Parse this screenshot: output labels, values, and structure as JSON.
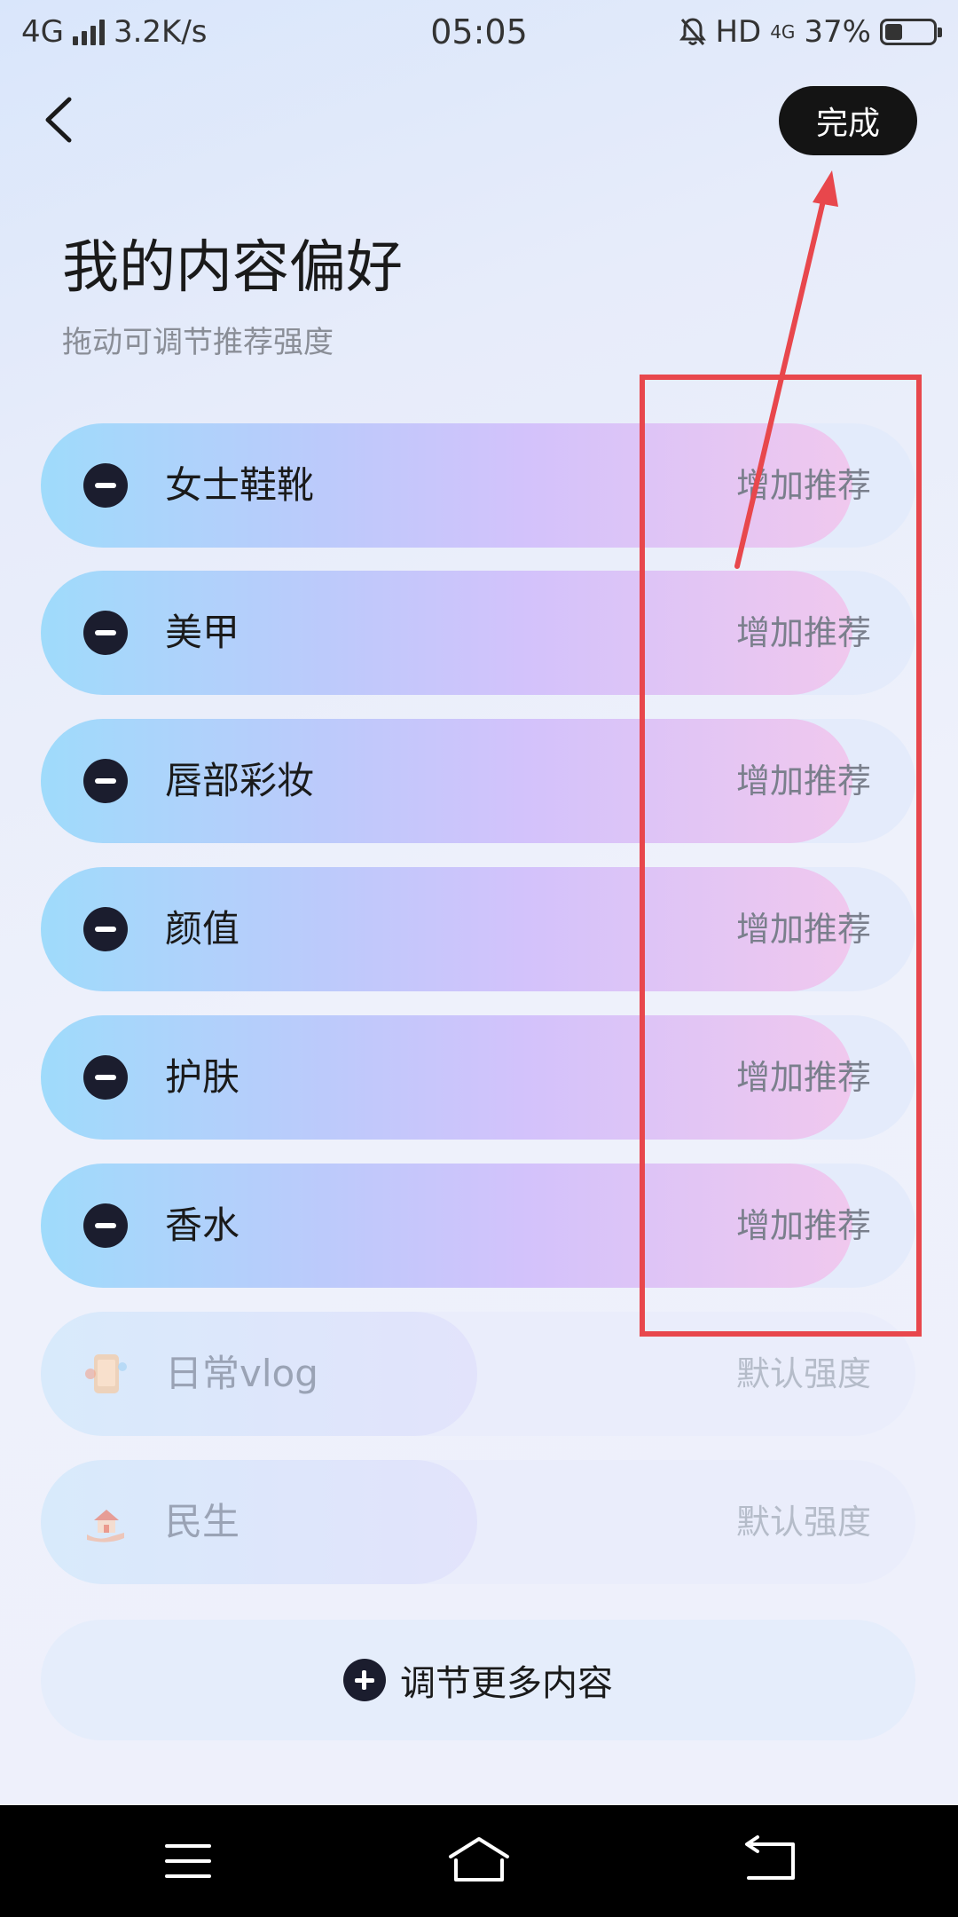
{
  "status_bar": {
    "network": "4G",
    "speed": "3.2K/s",
    "time": "05:05",
    "hd": "HD",
    "net_small": "4G",
    "battery_text": "37%",
    "battery_level": 0.37
  },
  "header": {
    "done_label": "完成",
    "title": "我的内容偏好",
    "subtitle": "拖动可调节推荐强度"
  },
  "preferences": [
    {
      "label": "女士鞋靴",
      "action": "增加推荐",
      "state": "active"
    },
    {
      "label": "美甲",
      "action": "增加推荐",
      "state": "active"
    },
    {
      "label": "唇部彩妆",
      "action": "增加推荐",
      "state": "active"
    },
    {
      "label": "颜值",
      "action": "增加推荐",
      "state": "active"
    },
    {
      "label": "护肤",
      "action": "增加推荐",
      "state": "active"
    },
    {
      "label": "香水",
      "action": "增加推荐",
      "state": "active"
    },
    {
      "label": "日常vlog",
      "action": "默认强度",
      "state": "default",
      "icon": "daily-vlog-icon"
    },
    {
      "label": "民生",
      "action": "默认强度",
      "state": "default",
      "icon": "livelihood-icon"
    }
  ],
  "more_button": {
    "label": "调节更多内容"
  },
  "colors": {
    "annotation_red": "#e8474c",
    "dark": "#141414",
    "active_gradient_start": "#9fdbfb",
    "active_gradient_end": "#f0c8ee"
  },
  "nav_bar": {
    "icons": [
      "menu-icon",
      "home-icon",
      "back-icon"
    ]
  }
}
